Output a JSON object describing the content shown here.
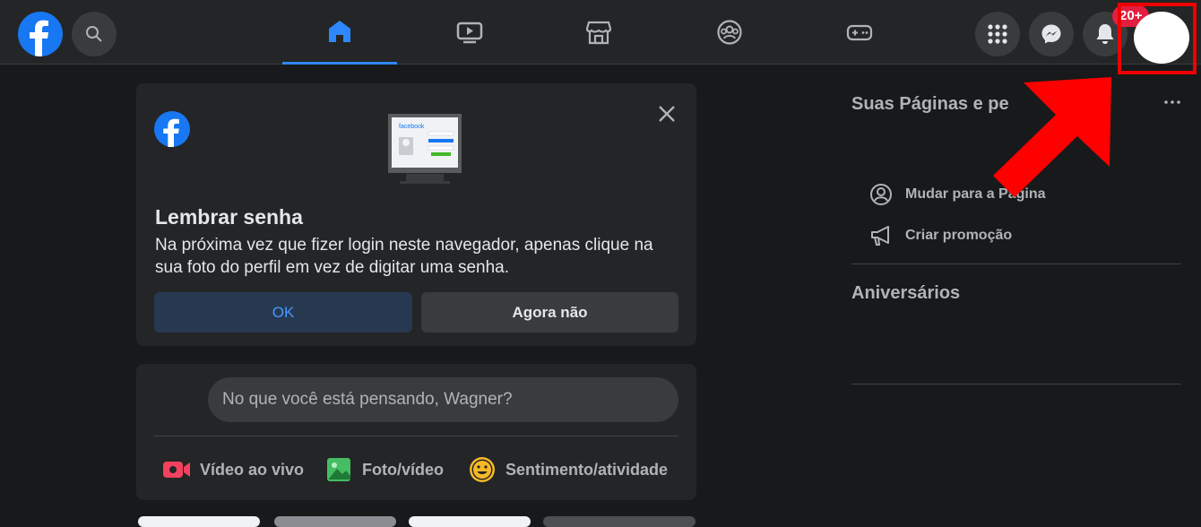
{
  "header": {
    "notifications_badge": "20+"
  },
  "remember_password": {
    "title": "Lembrar senha",
    "body": "Na próxima vez que fizer login neste navegador, apenas clique na sua foto do perfil em vez de digitar uma senha.",
    "ok_label": "OK",
    "not_now_label": "Agora não",
    "illustration_text": "facebook"
  },
  "composer": {
    "placeholder": "No que você está pensando, Wagner?",
    "actions": [
      {
        "label": "Vídeo ao vivo",
        "icon": "live-video-icon"
      },
      {
        "label": "Foto/vídeo",
        "icon": "photo-icon"
      },
      {
        "label": "Sentimento/atividade",
        "icon": "smiley-icon"
      }
    ]
  },
  "right_sidebar": {
    "pages_heading": "Suas Páginas e pe",
    "items": [
      {
        "label": "Mudar para a Página",
        "icon": "switch-profile-icon"
      },
      {
        "label": "Criar promoção",
        "icon": "megaphone-icon"
      }
    ],
    "birthdays_heading": "Aniversários"
  },
  "colors": {
    "accent": "#2d88ff",
    "brand": "#1877f2",
    "annotation": "#e00000"
  }
}
